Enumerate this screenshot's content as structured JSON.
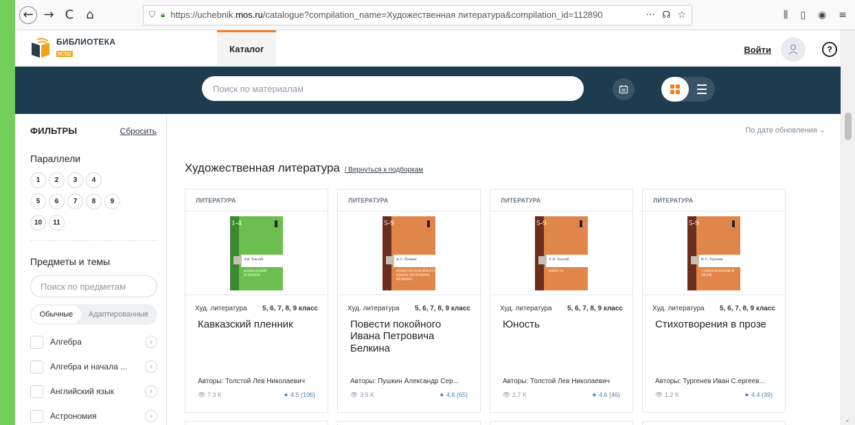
{
  "browser": {
    "back": "←",
    "forward": "→",
    "reload": "C",
    "home": "⌂",
    "url_prefix": "https://uchebnik.",
    "url_domain": "mos.ru",
    "url_rest": "/catalogue?compilation_name=Художественная литература&compilation_id=112890",
    "more": "···",
    "pocket": "☊",
    "star": "☆",
    "library": "⫼",
    "sidebar": "▯",
    "account": "◉",
    "menu": "≡"
  },
  "site": {
    "logo_line1": "БИБЛИОТЕКА",
    "logo_line2": "МЭШ",
    "tab_catalog": "Каталог",
    "login": "Войти",
    "help": "?"
  },
  "search": {
    "placeholder": "Поиск по материалам"
  },
  "filters": {
    "title": "ФИЛЬТРЫ",
    "reset": "Сбросить",
    "parallels_title": "Параллели",
    "grades": [
      "1",
      "2",
      "3",
      "4",
      "5",
      "6",
      "7",
      "8",
      "9",
      "10",
      "11"
    ],
    "subjects_title": "Предметы и темы",
    "subjects_placeholder": "Поиск по предметам",
    "mode_regular": "Обычные",
    "mode_adapted": "Адаптированные",
    "subjects": [
      "Алгебра",
      "Алгебра и начала ...",
      "Английский язык",
      "Астрономия"
    ],
    "arrow": "›"
  },
  "main": {
    "sort": "По дате обновления ⌄",
    "title": "Художественная литература",
    "back_link": "/ Вернуться к подборкам"
  },
  "cards": [
    {
      "category": "ЛИТЕРАТУРА",
      "type": "Худ. литература",
      "grades": "5, 6, 7, 8, 9 класс",
      "title": "Кавказский пленник",
      "author": "Авторы: Толстой Лев Николаевич",
      "views": "7.3 K",
      "rating": "★ 4.5 (106)",
      "cover_num": "1-4",
      "cover_author": "Л.Н. Толстой",
      "cover_title": "КАВКАЗСКИЙ ПЛЕННИК",
      "cover_color": "#6cbf4e",
      "strip_color": "#3a8a2e"
    },
    {
      "category": "ЛИТЕРАТУРА",
      "type": "Худ. литература",
      "grades": "5, 6, 7, 8, 9 класс",
      "title": "Повести покойного Ивана Петровича Белкина",
      "author": "Авторы: Пушкин Александр Сер...",
      "views": "3.5 K",
      "rating": "★ 4.6 (65)",
      "cover_num": "5-9",
      "cover_author": "А. С. Пушкин",
      "cover_title": "ПОВЕСТИ ПОКОЙНОГО ИВАНА ПЕТРОВИЧА БЕЛКИНА",
      "cover_color": "#e1864a",
      "strip_color": "#6b2d1e"
    },
    {
      "category": "ЛИТЕРАТУРА",
      "type": "Худ. литература",
      "grades": "5, 6, 7, 8, 9 класс",
      "title": "Юность",
      "author": "Авторы: Толстой Лев Николаевич",
      "views": "2.7 K",
      "rating": "★ 4.6 (46)",
      "cover_num": "5-9",
      "cover_author": "Л. Н. Толстой",
      "cover_title": "ЮНОСТЬ",
      "cover_color": "#e1864a",
      "strip_color": "#6b2d1e"
    },
    {
      "category": "ЛИТЕРАТУРА",
      "type": "Худ. литература",
      "grades": "5, 6, 7, 8, 9 класс",
      "title": "Стихотворения в прозе",
      "author": "Авторы: Тургенев Иван С.ергеев...",
      "views": "1.2 K",
      "rating": "★ 4.4 (39)",
      "cover_num": "5-9",
      "cover_author": "И. С. Тургенев",
      "cover_title": "СТИХОТВОРЕНИЯ В ПРОЗЕ",
      "cover_color": "#e1864a",
      "strip_color": "#6b2d1e"
    }
  ],
  "colors": {
    "accent": "#f17c21",
    "band": "#1e3c50"
  }
}
